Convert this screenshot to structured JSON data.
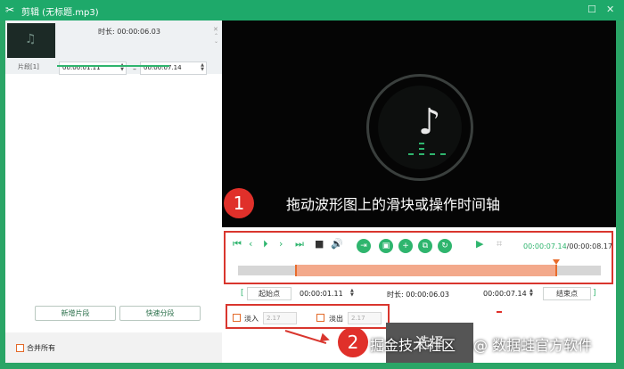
{
  "window": {
    "title": "剪辑 (无标题.mp3)",
    "icon": "scissors-icon"
  },
  "clip": {
    "label": "片段[1]",
    "duration_label": "时长:",
    "duration_value": "00:00:06.03",
    "start": "00:00:01.11",
    "end": "00:00:07.14",
    "separator": "–"
  },
  "left_buttons": {
    "new_segment": "新增片段",
    "quick_split": "快速分段"
  },
  "merge_all": "合并所有",
  "preview": {
    "icon": "music-note-icon"
  },
  "annotation1": {
    "number": "1",
    "text": "拖动波形图上的滑块或操作时间轴"
  },
  "annotation2": {
    "number": "2"
  },
  "timecode": {
    "current": "00:00:07.14",
    "separator": "/",
    "total": "00:00:08.17"
  },
  "trim": {
    "start_btn": "起始点",
    "start": "00:00:01.11",
    "duration_label": "时长:",
    "duration": "00:00:06.03",
    "end": "00:00:07.14",
    "end_btn": "结束点"
  },
  "fade": {
    "in_label": "淡入",
    "in_value": "2.17",
    "out_label": "淡出",
    "out_value": "2.17"
  },
  "select_button": "选择",
  "watermark": {
    "left": "掘金技术社区",
    "right": "@ 数据蛙官方软件"
  },
  "colors": {
    "brand": "#2fb56e",
    "title_bg": "#1ea96a",
    "annotation": "#d9362e",
    "selection": "#f3a98b"
  }
}
